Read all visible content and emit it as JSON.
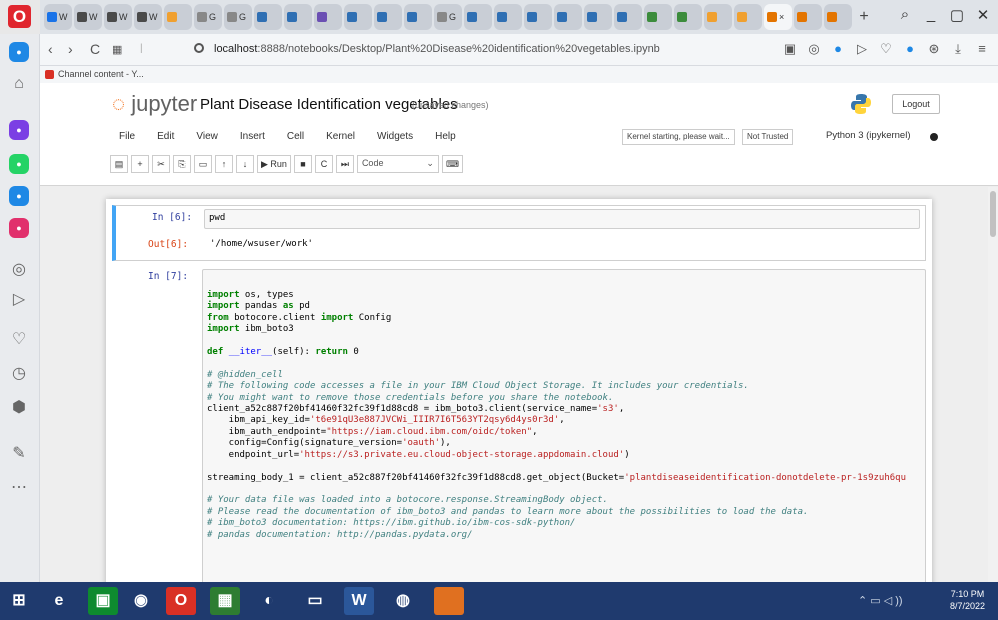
{
  "browser": {
    "brand_icon": "opera-icon",
    "tabs": [
      {
        "label": "W",
        "color": "#1a73e8"
      },
      {
        "label": "W",
        "color": "#4a4a4a"
      },
      {
        "label": "W",
        "color": "#4a4a4a"
      },
      {
        "label": "W",
        "color": "#4a4a4a"
      },
      {
        "label": "",
        "color": "#f0a030"
      },
      {
        "label": "G",
        "color": "#888888"
      },
      {
        "label": "G",
        "color": "#888888"
      },
      {
        "label": "",
        "color": "#2f6fb3"
      },
      {
        "label": "",
        "color": "#2f6fb3"
      },
      {
        "label": "",
        "color": "#6b4fb3"
      },
      {
        "label": "",
        "color": "#2f6fb3"
      },
      {
        "label": "",
        "color": "#2f6fb3"
      },
      {
        "label": "",
        "color": "#2f6fb3"
      },
      {
        "label": "G",
        "color": "#888888"
      },
      {
        "label": "",
        "color": "#2f6fb3"
      },
      {
        "label": "",
        "color": "#2f6fb3"
      },
      {
        "label": "",
        "color": "#2f6fb3"
      },
      {
        "label": "",
        "color": "#2f6fb3"
      },
      {
        "label": "",
        "color": "#2f6fb3"
      },
      {
        "label": "",
        "color": "#2f6fb3"
      },
      {
        "label": "",
        "color": "#3c8c3c"
      },
      {
        "label": "",
        "color": "#3c8c3c"
      },
      {
        "label": "",
        "color": "#f0a030"
      },
      {
        "label": "",
        "color": "#f0a030"
      },
      {
        "label": "",
        "color": "#e37400",
        "active": true
      },
      {
        "label": "",
        "color": "#e37400"
      },
      {
        "label": "",
        "color": "#e37400"
      }
    ],
    "new_tab_label": "+",
    "window_controls": [
      "search-icon",
      "minimize-icon",
      "maximize-icon",
      "close-icon"
    ],
    "address": {
      "back": "‹",
      "forward": "›",
      "reload": "C",
      "host": "localhost",
      "url_rest": ":8888/notebooks/Desktop/Plant%20Disease%20identification%20vegetables.ipynb"
    },
    "bookmark": "Channel content - Y..."
  },
  "sidebar_icons": [
    {
      "name": "messenger-icon",
      "color": "#1e88e5"
    },
    {
      "name": "home-icon",
      "color": ""
    },
    {
      "name": "messenger-icon",
      "color": "#7b3fe4"
    },
    {
      "name": "whatsapp-icon",
      "color": "#25d366"
    },
    {
      "name": "telegram-icon",
      "color": "#1e88e5"
    },
    {
      "name": "instagram-icon",
      "color": "#e1306c"
    },
    {
      "name": "player-icon",
      "color": ""
    },
    {
      "name": "send-icon",
      "color": ""
    },
    {
      "name": "heart-icon",
      "color": ""
    },
    {
      "name": "history-icon",
      "color": ""
    },
    {
      "name": "box-icon",
      "color": ""
    },
    {
      "name": "pin-icon",
      "color": ""
    },
    {
      "name": "more-icon",
      "color": ""
    }
  ],
  "jupyter": {
    "logo_text": "jupyter",
    "notebook_title": "Plant Disease Identification vegetables",
    "unsaved_label": "(unsaved changes)",
    "logout_label": "Logout",
    "menu": [
      "File",
      "Edit",
      "View",
      "Insert",
      "Cell",
      "Kernel",
      "Widgets",
      "Help"
    ],
    "kernel_status": "Kernel starting, please wait...",
    "trust_status": "Not Trusted",
    "kernel_name": "Python 3 (ipykernel)",
    "toolbar_buttons": [
      "save-icon",
      "add-cell-icon",
      "cut-icon",
      "copy-icon",
      "paste-icon",
      "move-up-icon",
      "move-down-icon"
    ],
    "run_label": "▶ Run",
    "cell_type": "Code"
  },
  "cells": {
    "c6_prompt": "In [6]:",
    "c6_code": "pwd",
    "c6_out_prompt": "Out[6]:",
    "c6_output": "'/home/wsuser/work'",
    "c7_prompt": "In [7]:",
    "c7_lines": [
      "import os, types",
      "import pandas as pd",
      "from botocore.client import Config",
      "import ibm_boto3",
      "",
      "def __iter__(self): return 0",
      "",
      "# @hidden_cell",
      "# The following code accesses a file in your IBM Cloud Object Storage. It includes your credentials.",
      "# You might want to remove those credentials before you share the notebook.",
      "client_a52c887f20bf41460f32fc39f1d88cd8 = ibm_boto3.client(service_name='s3',",
      "    ibm_api_key_id='t6e91qU3e887JVCWi_IIIR7I6T563YT2qsy6d4ys0r3d',",
      "    ibm_auth_endpoint=\"https://iam.cloud.ibm.com/oidc/token\",",
      "    config=Config(signature_version='oauth'),",
      "    endpoint_url='https://s3.private.eu.cloud-object-storage.appdomain.cloud')",
      "",
      "streaming_body_1 = client_a52c887f20bf41460f32fc39f1d88cd8.get_object(Bucket='plantdiseaseidentification-donotdelete-pr-1s9zuh6qu",
      "",
      "# Your data file was loaded into a botocore.response.StreamingBody object.",
      "# Please read the documentation of ibm_boto3 and pandas to learn more about the possibilities to load the data.",
      "# ibm_boto3 documentation: https://ibm.github.io/ibm-cos-sdk-python/",
      "# pandas documentation: http://pandas.pydata.org/"
    ]
  },
  "taskbar": {
    "apps": [
      {
        "name": "start-icon",
        "color": "#1f3a6e"
      },
      {
        "name": "edge-icon",
        "color": "#1f3a6e"
      },
      {
        "name": "store-icon",
        "color": "#0e8a2f"
      },
      {
        "name": "chrome-icon",
        "color": "#1f3a6e"
      },
      {
        "name": "opera-icon",
        "color": "#d93025"
      },
      {
        "name": "app-icon",
        "color": "#2e7d32"
      },
      {
        "name": "firefox-icon",
        "color": "#1f3a6e"
      },
      {
        "name": "files-icon",
        "color": "#1f3a6e"
      },
      {
        "name": "word-icon",
        "color": "#2b579a"
      },
      {
        "name": "app2-icon",
        "color": "#1f3a6e"
      },
      {
        "name": "app3-icon",
        "color": "#e07020"
      }
    ],
    "clock_time": "7:10 PM",
    "clock_date": "8/7/2022"
  }
}
